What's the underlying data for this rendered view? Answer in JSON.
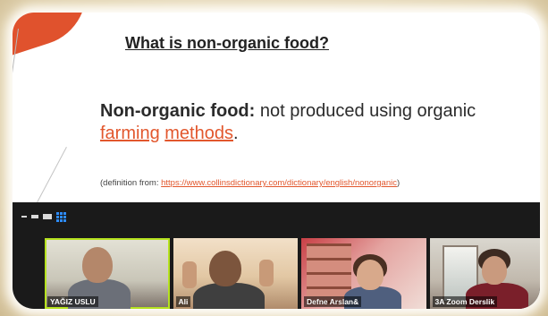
{
  "slide": {
    "title": "What is non-organic food?",
    "definition": {
      "term": "Non-organic food:",
      "text_part1": " not produced using organic ",
      "link1": "farming",
      "link2": "methods",
      "end": "."
    },
    "source": {
      "prefix": "(definition from: ",
      "url": "https://www.collinsdictionary.com/dictionary/english/nonorganic",
      "suffix": ")"
    }
  },
  "zoom": {
    "participants": [
      {
        "name": "YAĞIZ USLU",
        "active": true
      },
      {
        "name": "Ali",
        "active": false
      },
      {
        "name": "Defne Arslan&",
        "active": false
      },
      {
        "name": "3A Zoom Derslik",
        "active": false
      }
    ],
    "colors": {
      "active_border": "#b6e21f",
      "grid_icon": "#2d8cff",
      "link": "#e2572d"
    }
  }
}
